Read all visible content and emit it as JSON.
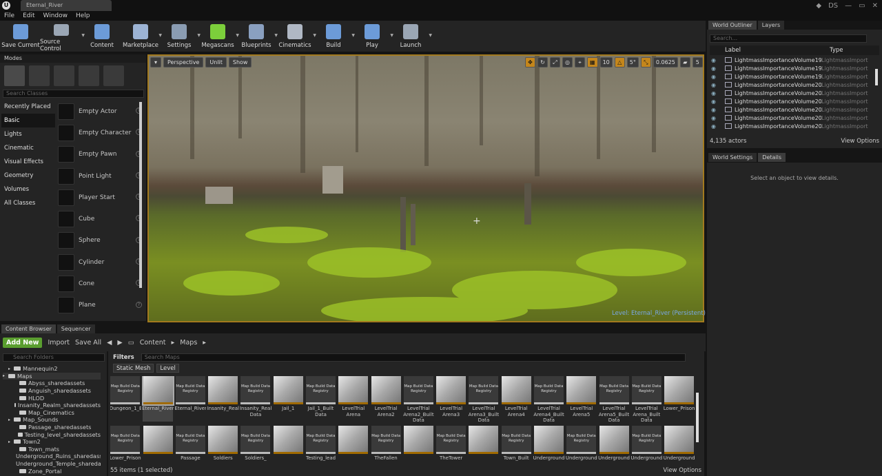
{
  "window": {
    "tab_title": "Eternal_River",
    "user_initials": "DS"
  },
  "menu": [
    "File",
    "Edit",
    "Window",
    "Help"
  ],
  "toolbar": [
    {
      "label": "Save Current",
      "icon": "save-icon",
      "color": "#6c9bd8"
    },
    {
      "label": "Source Control",
      "icon": "source-control-icon",
      "color": "#9aa6b4"
    },
    {
      "label": "Content",
      "icon": "content-icon",
      "color": "#6c9bd8"
    },
    {
      "label": "Marketplace",
      "icon": "marketplace-icon",
      "color": "#9cb3d4"
    },
    {
      "label": "Settings",
      "icon": "settings-icon",
      "color": "#8a9cb2"
    },
    {
      "label": "Megascans",
      "icon": "megascans-icon",
      "color": "#7ccf3b"
    },
    {
      "label": "Blueprints",
      "icon": "blueprints-icon",
      "color": "#8aa0c0"
    },
    {
      "label": "Cinematics",
      "icon": "cinematics-icon",
      "color": "#b0b8c4"
    },
    {
      "label": "Build",
      "icon": "build-icon",
      "color": "#6c9bd8"
    },
    {
      "label": "Play",
      "icon": "play-icon",
      "color": "#6c9bd8"
    },
    {
      "label": "Launch",
      "icon": "launch-icon",
      "color": "#9aa6b4"
    }
  ],
  "modes": {
    "tab": "Modes",
    "search_placeholder": "Search Classes",
    "categories": [
      "Recently Placed",
      "Basic",
      "Lights",
      "Cinematic",
      "Visual Effects",
      "Geometry",
      "Volumes",
      "All Classes"
    ],
    "selected_category": "Basic",
    "items": [
      "Empty Actor",
      "Empty Character",
      "Empty Pawn",
      "Point Light",
      "Player Start",
      "Cube",
      "Sphere",
      "Cylinder",
      "Cone",
      "Plane"
    ]
  },
  "viewport": {
    "perspective": "Perspective",
    "lit": "Unlit",
    "show": "Show",
    "grid_snap": "10",
    "rotation_snap": "5°",
    "scale_snap": "0.0625",
    "camera_speed": "5",
    "level_label": "Level:",
    "level_name": "Eternal_River (Persistent)"
  },
  "outliner": {
    "tabs": [
      "World Outliner",
      "Layers"
    ],
    "search_placeholder": "Search...",
    "col_label": "Label",
    "col_type": "Type",
    "rows": [
      {
        "label": "LightmassImportanceVolume197",
        "type": "LightmassImporta"
      },
      {
        "label": "LightmassImportanceVolume198",
        "type": "LightmassImporta"
      },
      {
        "label": "LightmassImportanceVolume199",
        "type": "LightmassImporta"
      },
      {
        "label": "LightmassImportanceVolume200",
        "type": "LightmassImporta"
      },
      {
        "label": "LightmassImportanceVolume201",
        "type": "LightmassImporta"
      },
      {
        "label": "LightmassImportanceVolume202",
        "type": "LightmassImporta"
      },
      {
        "label": "LightmassImportanceVolume203",
        "type": "LightmassImporta"
      },
      {
        "label": "LightmassImportanceVolume204",
        "type": "LightmassImporta"
      },
      {
        "label": "LightmassImportanceVolume205",
        "type": "LightmassImporta"
      }
    ],
    "actor_count": "4,135 actors",
    "view_options": "View Options"
  },
  "details": {
    "tabs": [
      "World Settings",
      "Details"
    ],
    "empty_message": "Select an object to view details."
  },
  "content_browser": {
    "tabs": [
      "Content Browser",
      "Sequencer"
    ],
    "add_new": "Add New",
    "import": "Import",
    "save_all": "Save All",
    "path": [
      "Content",
      "Maps"
    ],
    "folder_search_placeholder": "Search Folders",
    "folders": [
      {
        "name": "Mannequin2",
        "indent": 1,
        "arrow": true
      },
      {
        "name": "Maps",
        "indent": 0,
        "arrow": true,
        "selected": true
      },
      {
        "name": "Abyss_sharedassets",
        "indent": 2
      },
      {
        "name": "Anguish_sharedassets",
        "indent": 2
      },
      {
        "name": "HLOD",
        "indent": 2
      },
      {
        "name": "Insanity_Realm_sharedassets",
        "indent": 2
      },
      {
        "name": "Map_Cinematics",
        "indent": 2
      },
      {
        "name": "Map_Sounds",
        "indent": 1,
        "arrow": true
      },
      {
        "name": "Passage_sharedassets",
        "indent": 2
      },
      {
        "name": "Testing_level_sharedassets",
        "indent": 2
      },
      {
        "name": "Town2",
        "indent": 1,
        "arrow": true
      },
      {
        "name": "Town_mats",
        "indent": 2
      },
      {
        "name": "Underground_Ruins_sharedassets",
        "indent": 2
      },
      {
        "name": "Underground_Temple_sharedassets",
        "indent": 2
      },
      {
        "name": "Zone_Portal",
        "indent": 2
      }
    ],
    "filters": "Filters",
    "map_search_placeholder": "Search Maps",
    "chips": [
      "Static Mesh",
      "Level"
    ],
    "row1": [
      {
        "name": "Dungeon_1_BuiltData",
        "kind": "reg"
      },
      {
        "name": "Eternal_River",
        "kind": "map",
        "selected": true
      },
      {
        "name": "Eternal_River_BuiltData",
        "kind": "reg"
      },
      {
        "name": "Insanity_Realm",
        "kind": "map"
      },
      {
        "name": "Insanity_Realm_Built Data",
        "kind": "reg"
      },
      {
        "name": "Jail_1",
        "kind": "map"
      },
      {
        "name": "Jail_1_Built Data",
        "kind": "reg"
      },
      {
        "name": "LevelTrial Arena",
        "kind": "map"
      },
      {
        "name": "LevelTrial Arena2",
        "kind": "map"
      },
      {
        "name": "LevelTrial Arena2_Built Data",
        "kind": "reg"
      },
      {
        "name": "LevelTrial Arena3",
        "kind": "map"
      },
      {
        "name": "LevelTrial Arena3_Built Data",
        "kind": "reg"
      },
      {
        "name": "LevelTrial Arena4",
        "kind": "map"
      },
      {
        "name": "LevelTrial Arena4_Built Data",
        "kind": "reg"
      },
      {
        "name": "LevelTrial Arena5",
        "kind": "map"
      },
      {
        "name": "LevelTrial Arena5_Built Data",
        "kind": "reg"
      },
      {
        "name": "LevelTrial Arena_Built Data",
        "kind": "reg"
      },
      {
        "name": "Lower_Prison",
        "kind": "map"
      }
    ],
    "row2": [
      {
        "name": "Lower_Prison",
        "kind": "reg"
      },
      {
        "name": "",
        "kind": "map"
      },
      {
        "name": "Passage",
        "kind": "reg"
      },
      {
        "name": "Soldiers",
        "kind": "map"
      },
      {
        "name": "Soldiers_",
        "kind": "reg"
      },
      {
        "name": "",
        "kind": "map"
      },
      {
        "name": "Testing_lead",
        "kind": "reg"
      },
      {
        "name": "",
        "kind": "map"
      },
      {
        "name": "TheFallen",
        "kind": "reg"
      },
      {
        "name": "",
        "kind": "map"
      },
      {
        "name": "TheTower",
        "kind": "reg"
      },
      {
        "name": "",
        "kind": "map"
      },
      {
        "name": "Town_Built",
        "kind": "reg"
      },
      {
        "name": "Underground",
        "kind": "map"
      },
      {
        "name": "Underground",
        "kind": "reg"
      },
      {
        "name": "Underground",
        "kind": "map"
      },
      {
        "name": "Underground",
        "kind": "reg"
      },
      {
        "name": "Underground",
        "kind": "map"
      }
    ],
    "registry_label": "Map Build Data Registry",
    "item_count": "55 items (1 selected)",
    "view_options": "View Options"
  }
}
